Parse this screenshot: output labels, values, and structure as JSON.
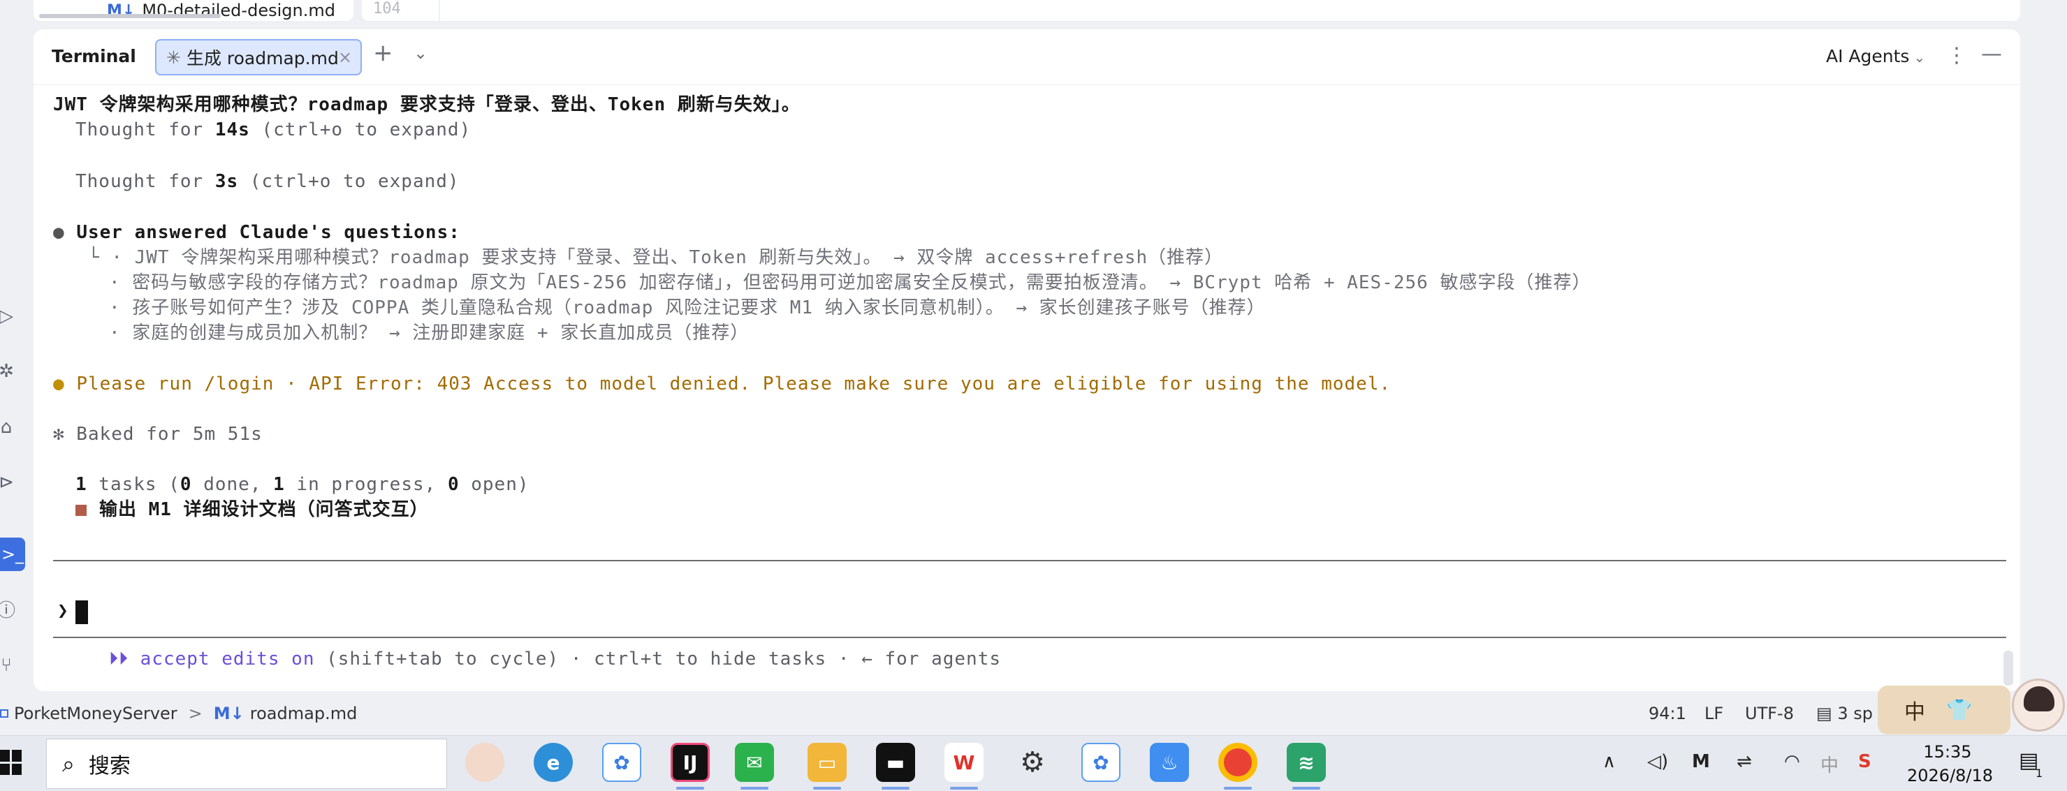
{
  "editor": {
    "file_tab_icon": "M↓",
    "file_tab_label": "M0-detailed-design.md",
    "line_number": "104"
  },
  "terminal": {
    "panel_title": "Terminal",
    "tab_spinner": "✳",
    "tab_label": "生成 roadmap.md",
    "tab_close": "×",
    "add_tab": "+",
    "tab_menu": "⌄",
    "agents_label": "AI Agents",
    "agents_chevron": "⌄",
    "more": "⋮",
    "minimize": "—"
  },
  "content": {
    "line1": "JWT 令牌架构采用哪种模式？roadmap 要求支持「登录、登出、Token 刷新与失效」。",
    "thought1_prefix": "Thought for ",
    "thought1_time": "14s",
    "thought1_suffix": " (ctrl+o to expand)",
    "thought2_prefix": "Thought for ",
    "thought2_time": "3s",
    "thought2_suffix": " (ctrl+o to expand)",
    "answers_bullet": "●",
    "answers_heading": "User answered Claude's questions:",
    "answers_corner": "└",
    "answers": [
      "· JWT 令牌架构采用哪种模式？roadmap 要求支持「登录、登出、Token 刷新与失效」。 → 双令牌 access+refresh（推荐）",
      "· 密码与敏感字段的存储方式？roadmap 原文为「AES-256 加密存储」，但密码用可逆加密属安全反模式，需要拍板澄清。 → BCrypt 哈希 + AES-256 敏感字段（推荐）",
      "· 孩子账号如何产生？涉及 COPPA 类儿童隐私合规（roadmap 风险注记要求 M1 纳入家长同意机制）。 → 家长创建孩子账号（推荐）",
      "· 家庭的创建与成员加入机制？ → 注册即建家庭 + 家长直加成员（推荐）"
    ],
    "error_bullet": "●",
    "error_text": "Please run /login · API Error: 403 Access to model denied. Please make sure you are eligible for using the model.",
    "baked_text": "✻ Baked for 5m 51s",
    "tasks_count": "1",
    "tasks_text_a": " tasks (",
    "tasks_done": "0",
    "tasks_text_b": " done, ",
    "tasks_progress": "1",
    "tasks_text_c": " in progress, ",
    "tasks_open": "0",
    "tasks_text_d": " open)",
    "task_item": "输出 M1 详细设计文档（问答式交互）",
    "prompt_caret": "❯",
    "hint_arrows": "⏵⏵",
    "hint_accept": " accept edits on",
    "hint_rest": " (shift+tab to cycle) · ctrl+t to hide tasks · ← for agents"
  },
  "sidebar": {
    "icons": [
      "run-icon",
      "debug-icon",
      "build-icon",
      "services-icon",
      "terminal-icon",
      "problems-icon",
      "git-icon"
    ]
  },
  "status": {
    "project": "PorketMoneyServer",
    "sep": ">",
    "file_icon": "M↓",
    "file": "roadmap.md",
    "position": "94:1",
    "line_ending": "LF",
    "encoding": "UTF-8",
    "indent": "3 sp"
  },
  "ime": {
    "mode": "中",
    "skin_icon": "shirt-icon"
  },
  "taskbar": {
    "search_placeholder": "搜索",
    "apps": [
      "avatar-app",
      "edge-browser",
      "baidu-netdisk",
      "intellij-idea",
      "wechat",
      "file-explorer",
      "terminal",
      "wps-office",
      "settings",
      "baidu-netdisk-2",
      "gourd-app",
      "chrome",
      "layers-app"
    ],
    "tray": {
      "chevron": "∧",
      "volume": "🔊",
      "ime_lang": "中",
      "time": "15:35",
      "date": "2026/8/18",
      "notification_count": "1"
    }
  },
  "colors": {
    "accent_blue": "#3d6fe0",
    "warning_text": "#a26b00",
    "task_marker": "#b35b4a",
    "accept_purple": "#6b4fd8"
  }
}
